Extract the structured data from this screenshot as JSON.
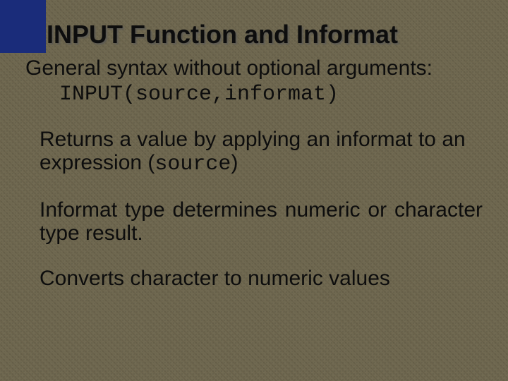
{
  "title": "INPUT Function and Informat",
  "intro": "General syntax without optional arguments:",
  "code": "INPUT(source,informat)",
  "p1_a": "Returns a value by applying an informat to an expression (",
  "p1_mono": "source",
  "p1_b": ")",
  "p2": "Informat type determines numeric or character type result.",
  "p3": "Converts character to numeric values"
}
